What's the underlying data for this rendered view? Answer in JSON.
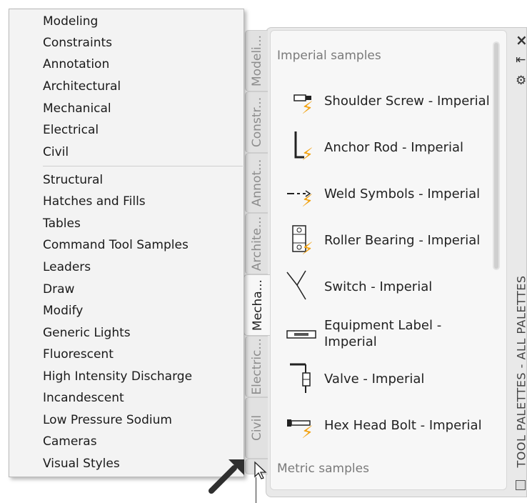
{
  "context_menu": {
    "group1": [
      "Modeling",
      "Constraints",
      "Annotation",
      "Architectural",
      "Mechanical",
      "Electrical",
      "Civil"
    ],
    "group2": [
      "Structural",
      "Hatches and Fills",
      "Tables",
      "Command Tool Samples",
      "Leaders",
      "Draw",
      "Modify",
      "Generic Lights",
      "Fluorescent",
      "High Intensity Discharge",
      "Incandescent",
      "Low Pressure Sodium",
      "Cameras",
      "Visual Styles"
    ]
  },
  "tabs": [
    "Modeli...",
    "Constr...",
    "Annot...",
    "Archite...",
    "Mecha...",
    "Electric...",
    "Civil"
  ],
  "active_tab": "Mecha...",
  "palette": {
    "section_imperial": "Imperial samples",
    "section_metric": "Metric samples",
    "tools": [
      {
        "label": "Shoulder Screw - Imperial",
        "icon": "shoulder-screw-icon"
      },
      {
        "label": "Anchor Rod - Imperial",
        "icon": "anchor-rod-icon"
      },
      {
        "label": "Weld Symbols - Imperial",
        "icon": "weld-symbols-icon"
      },
      {
        "label": "Roller Bearing - Imperial",
        "icon": "roller-bearing-icon"
      },
      {
        "label": "Switch - Imperial",
        "icon": "switch-icon"
      },
      {
        "label": "Equipment Label - Imperial",
        "icon": "equipment-label-icon"
      },
      {
        "label": "Valve - Imperial",
        "icon": "valve-icon"
      },
      {
        "label": "Hex Head Bolt - Imperial",
        "icon": "hex-head-bolt-icon"
      }
    ]
  },
  "right_strip": {
    "title": "TOOL PALETTES - ALL PALETTES",
    "close": "×",
    "autohide": "⇤",
    "properties": "⚙"
  }
}
